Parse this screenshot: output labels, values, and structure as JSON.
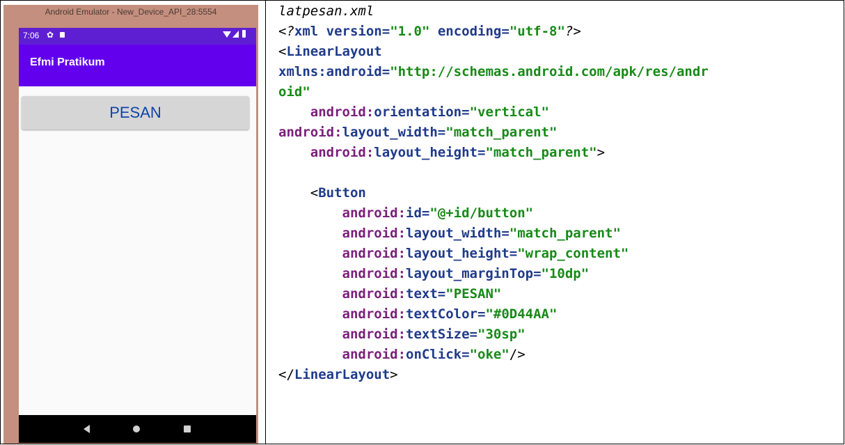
{
  "emulator": {
    "window_title": "Android Emulator - New_Device_API_28:5554",
    "status_time": "7:06",
    "app_title": "Efmi Pratikum",
    "button_label": "PESAN",
    "button_color": "#0D44AA",
    "icons": [
      "gear-icon",
      "sd-card-icon",
      "wifi-icon",
      "signal-icon",
      "battery-icon",
      "back-icon",
      "home-icon",
      "recents-icon"
    ]
  },
  "code": {
    "filename": "latpesan.xml",
    "lines": [
      {
        "indent": "",
        "parts": [
          [
            "pi",
            "<?"
          ],
          [
            "tag",
            "xml"
          ],
          [
            "eq",
            " "
          ],
          [
            "attrname",
            "version"
          ],
          [
            "eq",
            "="
          ],
          [
            "val",
            "\"1.0\""
          ],
          [
            "eq",
            " "
          ],
          [
            "attrname",
            "encoding"
          ],
          [
            "eq",
            "="
          ],
          [
            "val",
            "\"utf-8\""
          ],
          [
            "pi",
            "?"
          ],
          [
            "bk",
            ">"
          ]
        ]
      },
      {
        "indent": "",
        "parts": [
          [
            "bk",
            "<"
          ],
          [
            "tag",
            "LinearLayout"
          ]
        ]
      },
      {
        "indent": "",
        "parts": [
          [
            "attrname",
            "xmlns:android"
          ],
          [
            "eq",
            "="
          ],
          [
            "val",
            "\"http://schemas.android.com/apk/res/andr"
          ]
        ]
      },
      {
        "indent": "",
        "parts": [
          [
            "val",
            "oid\""
          ]
        ]
      },
      {
        "indent": "    ",
        "parts": [
          [
            "attr",
            "android:"
          ],
          [
            "attrname",
            "orientation"
          ],
          [
            "eq",
            "="
          ],
          [
            "val",
            "\"vertical\""
          ]
        ]
      },
      {
        "indent": "",
        "parts": [
          [
            "attr",
            "android:"
          ],
          [
            "attrname",
            "layout_width"
          ],
          [
            "eq",
            "="
          ],
          [
            "val",
            "\"match_parent\""
          ]
        ]
      },
      {
        "indent": "    ",
        "parts": [
          [
            "attr",
            "android:"
          ],
          [
            "attrname",
            "layout_height"
          ],
          [
            "eq",
            "="
          ],
          [
            "val",
            "\"match_parent\""
          ],
          [
            "bk",
            ">"
          ]
        ]
      },
      {
        "indent": "",
        "parts": []
      },
      {
        "indent": "    ",
        "parts": [
          [
            "bk",
            "<"
          ],
          [
            "tag",
            "Button"
          ]
        ]
      },
      {
        "indent": "        ",
        "parts": [
          [
            "attr",
            "android:"
          ],
          [
            "attrname",
            "id"
          ],
          [
            "eq",
            "="
          ],
          [
            "val",
            "\"@+id/button\""
          ]
        ]
      },
      {
        "indent": "        ",
        "parts": [
          [
            "attr",
            "android:"
          ],
          [
            "attrname",
            "layout_width"
          ],
          [
            "eq",
            "="
          ],
          [
            "val",
            "\"match_parent\""
          ]
        ]
      },
      {
        "indent": "        ",
        "parts": [
          [
            "attr",
            "android:"
          ],
          [
            "attrname",
            "layout_height"
          ],
          [
            "eq",
            "="
          ],
          [
            "val",
            "\"wrap_content\""
          ]
        ]
      },
      {
        "indent": "        ",
        "parts": [
          [
            "attr",
            "android:"
          ],
          [
            "attrname",
            "layout_marginTop"
          ],
          [
            "eq",
            "="
          ],
          [
            "val",
            "\"10dp\""
          ]
        ]
      },
      {
        "indent": "        ",
        "parts": [
          [
            "attr",
            "android:"
          ],
          [
            "attrname",
            "text"
          ],
          [
            "eq",
            "="
          ],
          [
            "val",
            "\"PESAN\""
          ]
        ]
      },
      {
        "indent": "        ",
        "parts": [
          [
            "attr",
            "android:"
          ],
          [
            "attrname",
            "textColor"
          ],
          [
            "eq",
            "="
          ],
          [
            "val",
            "\"#0D44AA\""
          ]
        ]
      },
      {
        "indent": "        ",
        "parts": [
          [
            "attr",
            "android:"
          ],
          [
            "attrname",
            "textSize"
          ],
          [
            "eq",
            "="
          ],
          [
            "val",
            "\"30sp\""
          ]
        ]
      },
      {
        "indent": "        ",
        "parts": [
          [
            "attr",
            "android:"
          ],
          [
            "attrname",
            "onClick"
          ],
          [
            "eq",
            "="
          ],
          [
            "val",
            "\"oke\""
          ],
          [
            "bk",
            "/>"
          ]
        ]
      },
      {
        "indent": "",
        "parts": [
          [
            "bk",
            "</"
          ],
          [
            "tag",
            "LinearLayout"
          ],
          [
            "bk",
            ">"
          ]
        ]
      }
    ]
  }
}
